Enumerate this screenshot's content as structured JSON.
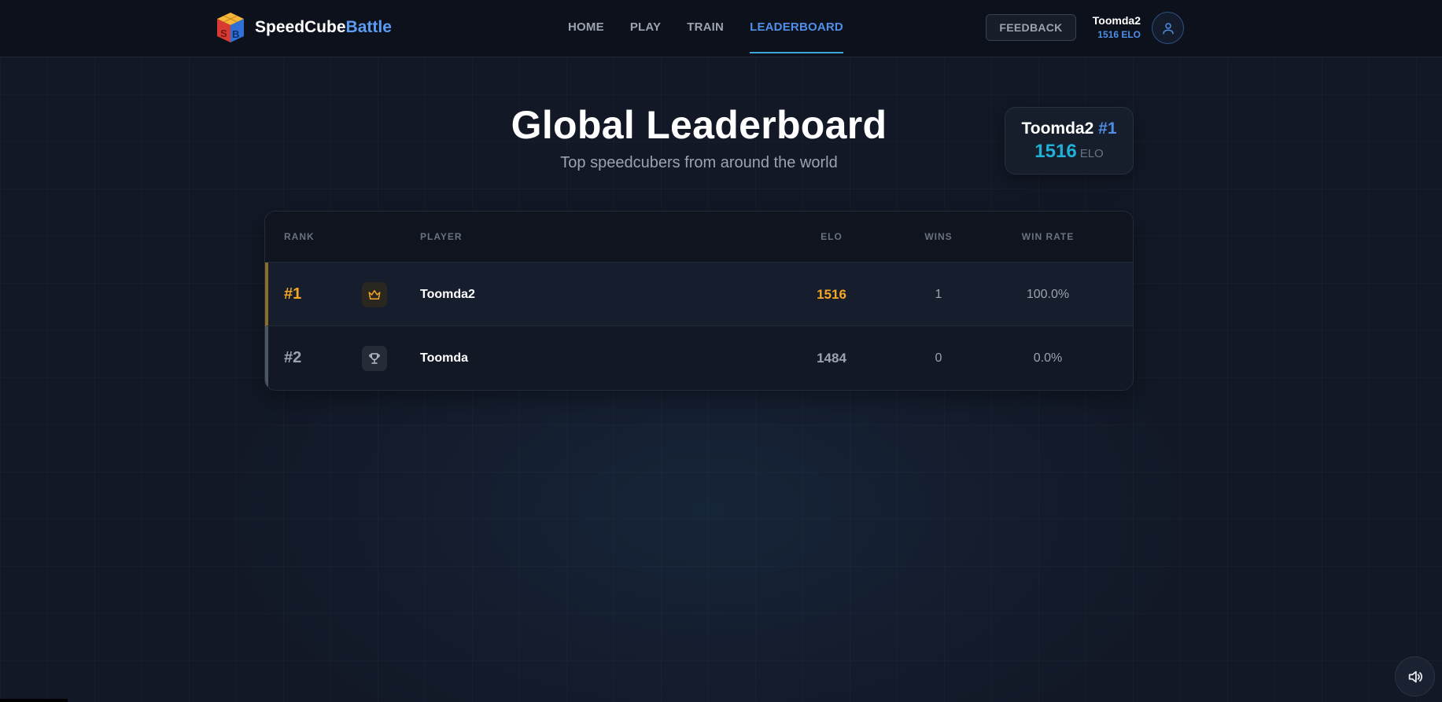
{
  "brand": {
    "name_main": "SpeedCube",
    "name_accent": "Battle",
    "logo_icon": "cube-logo-icon"
  },
  "nav": {
    "items": [
      {
        "label": "HOME",
        "active": false
      },
      {
        "label": "PLAY",
        "active": false
      },
      {
        "label": "TRAIN",
        "active": false
      },
      {
        "label": "LEADERBOARD",
        "active": true
      }
    ]
  },
  "header_actions": {
    "feedback_label": "FEEDBACK",
    "user_name": "Toomda2",
    "user_elo": "1516 ELO",
    "avatar_icon": "user-icon"
  },
  "page": {
    "title": "Global Leaderboard",
    "subtitle": "Top speedcubers from around the world"
  },
  "rank_card": {
    "name": "Toomda2",
    "rank": "#1",
    "elo": "1516",
    "unit": "ELO"
  },
  "table": {
    "columns": [
      "RANK",
      "PLAYER",
      "ELO",
      "WINS",
      "WIN RATE"
    ],
    "rows": [
      {
        "rank": "#1",
        "icon": "crown-icon",
        "player": "Toomda2",
        "elo": "1516",
        "wins": "1",
        "win_rate": "100.0%"
      },
      {
        "rank": "#2",
        "icon": "trophy-icon",
        "player": "Toomda",
        "elo": "1484",
        "wins": "0",
        "win_rate": "0.0%"
      }
    ]
  },
  "sound_button_icon": "speaker-icon",
  "colors": {
    "accent_blue": "#4f8fe8",
    "elo_cyan": "#20b0d8",
    "gold": "#f5a623",
    "silver": "#9ca3af",
    "background": "#121826"
  }
}
